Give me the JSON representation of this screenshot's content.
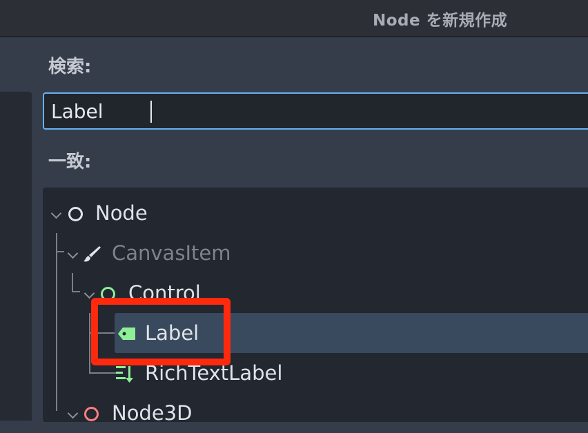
{
  "window": {
    "title": "Node を新規作成"
  },
  "search": {
    "label": "検索:",
    "value": "Label"
  },
  "matches": {
    "label": "一致:",
    "items": [
      {
        "label": "Node",
        "icon": "node-circle-icon",
        "color": "#e2e4e8"
      },
      {
        "label": "CanvasItem",
        "icon": "brush-icon",
        "color": "#e2e4e8",
        "dimmed": true
      },
      {
        "label": "Control",
        "icon": "control-circle-icon",
        "color": "#8eef97"
      },
      {
        "label": "Label",
        "icon": "label-tag-icon",
        "color": "#8eef97",
        "selected": true
      },
      {
        "label": "RichTextLabel",
        "icon": "rich-text-icon",
        "color": "#8eef97"
      },
      {
        "label": "Node3D",
        "icon": "node3d-circle-icon",
        "color": "#fc7f7f"
      }
    ]
  },
  "colors": {
    "accent": "#68b1f5",
    "highlight": "#ff2a0e",
    "selection": "#3a4a5e"
  }
}
